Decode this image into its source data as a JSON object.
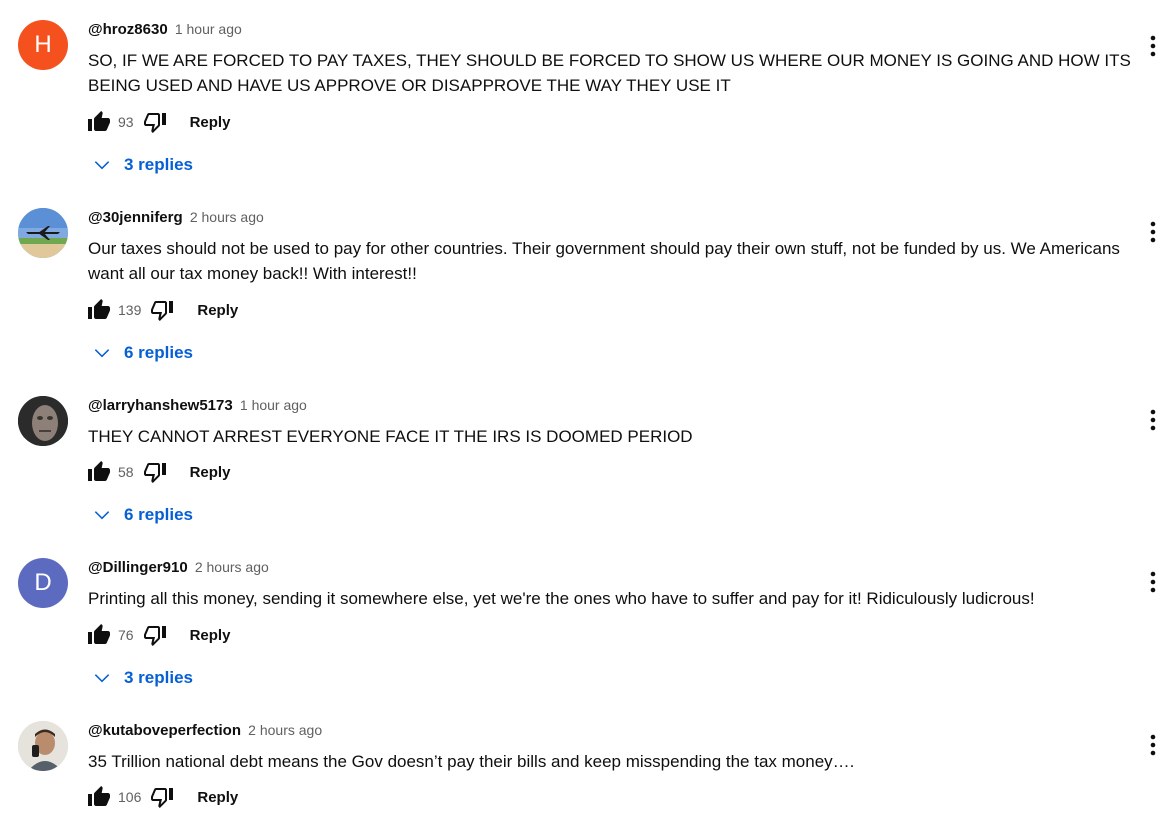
{
  "colors": {
    "author_text": "#0f0f0f",
    "timestamp_text": "#606060",
    "replies_link": "#065fd4",
    "avatar_h": "#f4511e",
    "avatar_d": "#5c6bc0"
  },
  "comments": [
    {
      "author": "@hroz8630",
      "time": "1 hour ago",
      "text": "SO, IF WE ARE FORCED TO PAY TAXES,  THEY SHOULD BE FORCED TO SHOW US WHERE OUR MONEY IS GOING AND HOW ITS BEING USED AND HAVE US APPROVE OR DISAPPROVE THE WAY THEY USE IT",
      "likes": "93",
      "reply_label": "Reply",
      "replies_label": "3 replies",
      "avatar_letter": "H",
      "avatar_icon": "letter-avatar"
    },
    {
      "author": "@30jenniferg",
      "time": "2 hours ago",
      "text": "Our taxes should not be used to pay for other countries.  Their government should pay their own stuff,  not be funded by us. We Americans want all our tax money back!! With interest!!",
      "likes": "139",
      "reply_label": "Reply",
      "replies_label": "6 replies",
      "avatar_icon": "airplane-photo-avatar"
    },
    {
      "author": "@larryhanshew5173",
      "time": "1 hour ago",
      "text": "THEY CANNOT ARREST EVERYONE FACE IT THE IRS IS DOOMED PERIOD",
      "likes": "58",
      "reply_label": "Reply",
      "replies_label": "6 replies",
      "avatar_icon": "face-photo-avatar"
    },
    {
      "author": "@Dillinger910",
      "time": "2 hours ago",
      "text": "Printing all this money, sending it somewhere else, yet we're the ones who have to suffer and pay for it! Ridiculously ludicrous!",
      "likes": "76",
      "reply_label": "Reply",
      "replies_label": "3 replies",
      "avatar_letter": "D",
      "avatar_icon": "letter-avatar"
    },
    {
      "author": "@kutaboveperfection",
      "time": "2 hours ago",
      "text": "35 Trillion national debt means the Gov doesn’t pay their bills and keep misspending the tax money….",
      "likes": "106",
      "reply_label": "Reply",
      "avatar_icon": "person-photo-avatar"
    }
  ]
}
